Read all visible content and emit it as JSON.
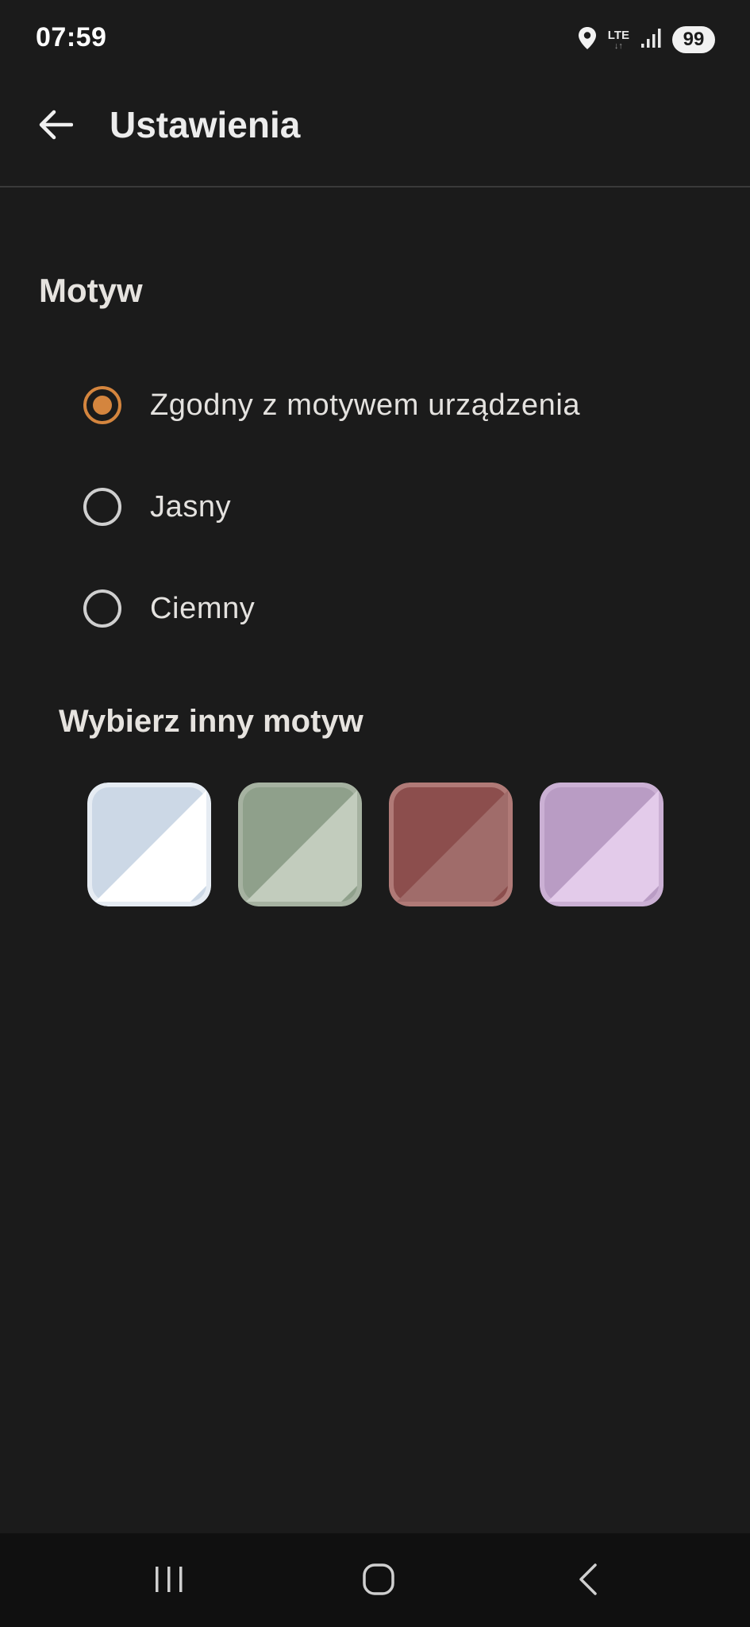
{
  "status_bar": {
    "time": "07:59",
    "network": "LTE",
    "battery": "99",
    "icons": [
      "location-icon",
      "lte-icon",
      "signal-icon",
      "battery-icon"
    ]
  },
  "app_bar": {
    "title": "Ustawienia",
    "back_icon": "arrow-back-icon"
  },
  "theme_section": {
    "title": "Motyw",
    "options": [
      {
        "label": "Zgodny z motywem urządzenia",
        "selected": true
      },
      {
        "label": "Jasny",
        "selected": false
      },
      {
        "label": "Ciemny",
        "selected": false
      }
    ]
  },
  "color_themes": {
    "title": "Wybierz inny motyw",
    "swatches": [
      {
        "name": "blue",
        "dark": "#ccd8e6",
        "light": "#ffffff",
        "border": "#e6ecf3"
      },
      {
        "name": "green",
        "dark": "#8fa08b",
        "light": "#c2ccbd",
        "border": "#a6b2a1"
      },
      {
        "name": "red",
        "dark": "#8c4e4d",
        "light": "#a06c6a",
        "border": "#b07a77"
      },
      {
        "name": "purple",
        "dark": "#b99cc4",
        "light": "#e3cbea",
        "border": "#cbb0d4"
      }
    ]
  },
  "nav_bar": {
    "icons": [
      "recent-apps-icon",
      "home-icon",
      "back-icon"
    ]
  },
  "colors": {
    "background": "#1b1b1b",
    "accent": "#d4853e",
    "nav_background": "#101010"
  }
}
